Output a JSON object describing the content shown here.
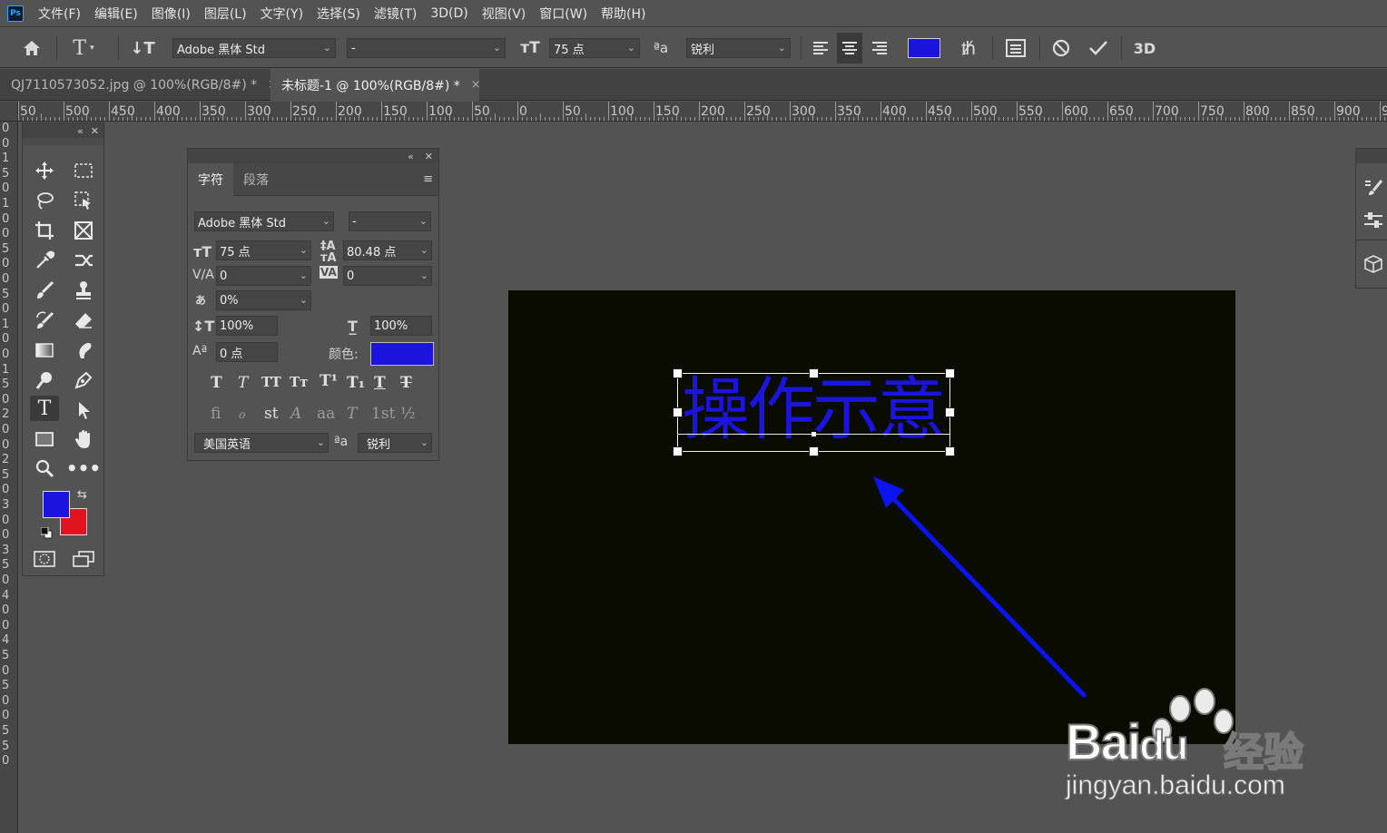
{
  "app": {
    "logo": "Ps"
  },
  "menu": [
    "文件(F)",
    "编辑(E)",
    "图像(I)",
    "图层(L)",
    "文字(Y)",
    "选择(S)",
    "滤镜(T)",
    "3D(D)",
    "视图(V)",
    "窗口(W)",
    "帮助(H)"
  ],
  "options": {
    "font_family": "Adobe 黑体 Std",
    "font_style": "-",
    "font_size": "75 点",
    "antialias": "锐利",
    "text_color": "#1a14dc",
    "three_d_label": "3D"
  },
  "tabs": [
    {
      "label": "QJ7110573052.jpg @ 100%(RGB/8#) *",
      "active": false
    },
    {
      "label": "未标题-1 @ 100%(RGB/8#) *",
      "active": true
    }
  ],
  "hruler_labels": [
    "50",
    "500",
    "450",
    "400",
    "350",
    "300",
    "250",
    "200",
    "150",
    "100",
    "50",
    "0",
    "50",
    "100",
    "150",
    "200",
    "250",
    "300",
    "350",
    "400",
    "450",
    "500",
    "550",
    "600",
    "650",
    "700",
    "750",
    "800",
    "850",
    "900",
    "95"
  ],
  "vruler_labels": [
    "0",
    "0",
    "1",
    "5",
    "0",
    "1",
    "0",
    "0",
    "5",
    "0",
    "0",
    "5",
    "0",
    "1",
    "0",
    "0",
    "1",
    "5",
    "0",
    "2",
    "0",
    "0",
    "2",
    "5",
    "0",
    "3",
    "0",
    "0",
    "3",
    "5",
    "0",
    "4",
    "0",
    "0",
    "4",
    "5",
    "0",
    "5",
    "0",
    "0",
    "5",
    "5",
    "0"
  ],
  "toolbox": {
    "foreground_color": "#1a14dc",
    "background_color": "#e0141e"
  },
  "character_panel": {
    "tab_character": "字符",
    "tab_paragraph": "段落",
    "font_family": "Adobe 黑体 Std",
    "font_style": "-",
    "font_size": "75 点",
    "leading": "80.48 点",
    "kerning": "0",
    "tracking": "0",
    "tsume": "0%",
    "vertical_scale": "100%",
    "horizontal_scale": "100%",
    "baseline_shift": "0 点",
    "color_label": "颜色:",
    "color": "#1a14dc",
    "language": "美国英语",
    "antialias": "锐利",
    "antialias_icon": "ªa"
  },
  "canvas": {
    "text": "操作示意"
  },
  "watermark": {
    "brand": "Bai",
    "brand2": "du",
    "cn": "经验",
    "url": "jingyan.baidu.com"
  }
}
